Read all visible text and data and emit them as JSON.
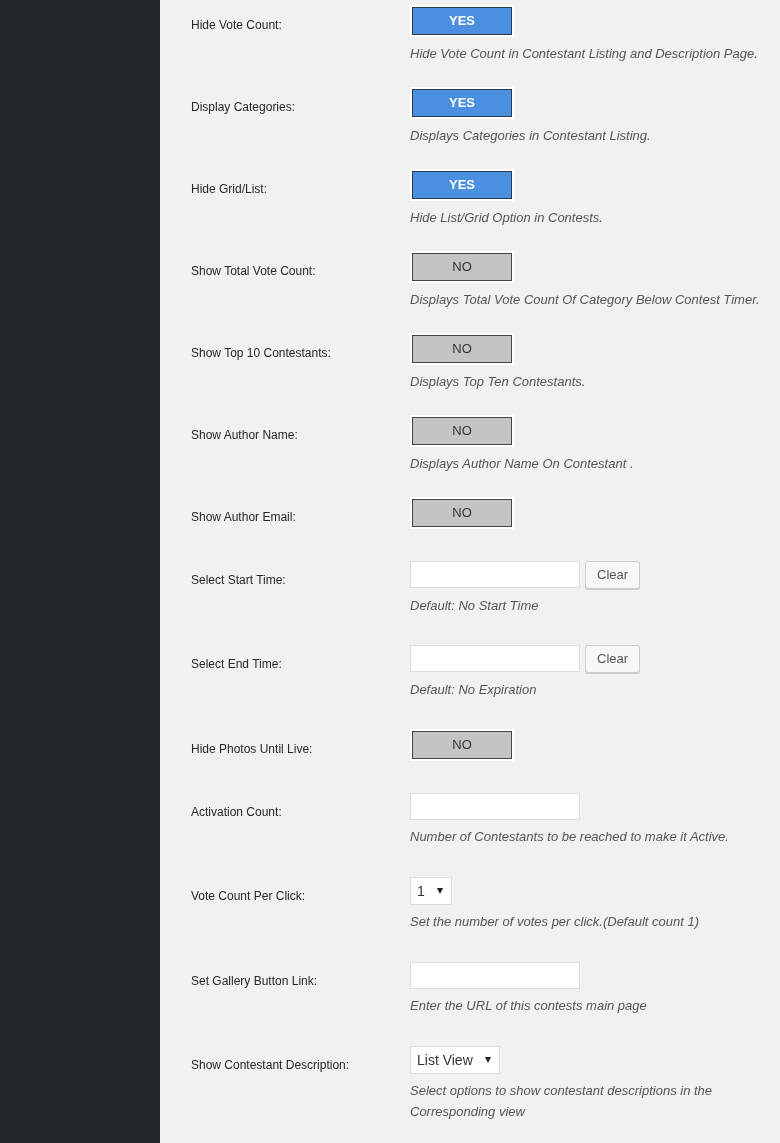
{
  "settings": [
    {
      "kind": "toggle",
      "label": "Hide Vote Count:",
      "on": true,
      "value": "YES",
      "description": "Hide Vote Count in Contestant Listing and Description Page."
    },
    {
      "kind": "toggle",
      "label": "Display Categories:",
      "on": true,
      "value": "YES",
      "description": "Displays Categories in Contestant Listing."
    },
    {
      "kind": "toggle",
      "label": "Hide Grid/List:",
      "on": true,
      "value": "YES",
      "description": "Hide List/Grid Option in Contests."
    },
    {
      "kind": "toggle",
      "label": "Show Total Vote Count:",
      "on": false,
      "value": "NO",
      "description": "Displays Total Vote Count Of Category Below Contest Timer."
    },
    {
      "kind": "toggle",
      "label": "Show Top 10 Contestants:",
      "on": false,
      "value": "NO",
      "description": "Displays Top Ten Contestants."
    },
    {
      "kind": "toggle",
      "label": "Show Author Name:",
      "on": false,
      "value": "NO",
      "description": "Displays Author Name On Contestant ."
    },
    {
      "kind": "toggle",
      "label": "Show Author Email:",
      "on": false,
      "value": "NO"
    },
    {
      "kind": "datetime",
      "label": "Select Start Time:",
      "button": "Clear",
      "description": "Default: No Start Time"
    },
    {
      "kind": "datetime",
      "label": "Select End Time:",
      "button": "Clear",
      "description": "Default: No Expiration"
    },
    {
      "kind": "toggle",
      "label": "Hide Photos Until Live:",
      "on": false,
      "value": "NO"
    },
    {
      "kind": "text",
      "label": "Activation Count:",
      "description": "Number of Contestants to be reached to make it Active."
    },
    {
      "kind": "select",
      "label": "Vote Count Per Click:",
      "value": "1",
      "description": "Set the number of votes per click.(Default count 1)"
    },
    {
      "kind": "text",
      "label": "Set Gallery Button Link:",
      "description": "Enter the URL of this contests main page"
    },
    {
      "kind": "select",
      "label": "Show Contestant Description:",
      "value": "List View",
      "description": "Select options to show contestant descriptions in the Corresponding view"
    }
  ]
}
